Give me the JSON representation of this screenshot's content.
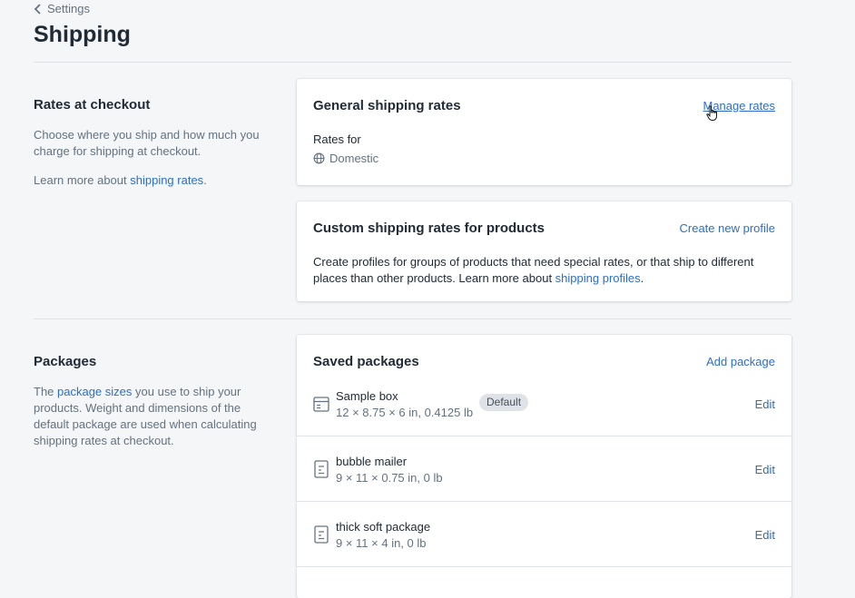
{
  "breadcrumb": {
    "label": "Settings"
  },
  "page": {
    "title": "Shipping"
  },
  "rates_section": {
    "title": "Rates at checkout",
    "description": "Choose where you ship and how much you charge for shipping at checkout.",
    "learn_prefix": "Learn more about ",
    "learn_link": "shipping rates",
    "learn_suffix": "."
  },
  "general_rates": {
    "title": "General shipping rates",
    "action": "Manage rates",
    "rates_for_label": "Rates for",
    "rates_for_value": "Domestic"
  },
  "custom_rates": {
    "title": "Custom shipping rates for products",
    "action": "Create new profile",
    "description": "Create profiles for groups of products that need special rates, or that ship to different places than other products. Learn more about ",
    "link": "shipping profiles",
    "suffix": "."
  },
  "packages_section": {
    "title": "Packages",
    "desc_prefix": "The ",
    "desc_link": "package sizes",
    "desc_suffix": " you use to ship your products. Weight and dimensions of the default package are used when calculating shipping rates at checkout."
  },
  "saved_packages": {
    "title": "Saved packages",
    "action": "Add package",
    "default_badge": "Default",
    "edit_label": "Edit",
    "items": [
      {
        "name": "Sample box",
        "dims": "12 × 8.75 × 6 in, 0.4125 lb",
        "icon": "box-icon"
      },
      {
        "name": "bubble mailer",
        "dims": "9 × 11 × 0.75 in, 0 lb",
        "icon": "envelope-icon"
      },
      {
        "name": "thick soft package",
        "dims": "9 × 11 × 4 in, 0 lb",
        "icon": "envelope-icon"
      }
    ]
  },
  "colors": {
    "link": "#2c6ecb",
    "text": "#212b36",
    "subdued": "#637381",
    "background": "#f4f6f8"
  }
}
